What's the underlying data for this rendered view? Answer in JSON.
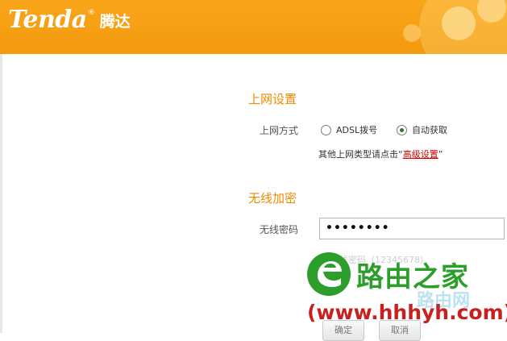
{
  "header": {
    "brand_en": "Tenda",
    "brand_reg": "®",
    "brand_cn": "腾达",
    "bg_color": "#f6a016"
  },
  "internet": {
    "section_title": "上网设置",
    "mode_label": "上网方式",
    "options": [
      {
        "label": "ADSL拨号",
        "selected": false
      },
      {
        "label": "自动获取",
        "selected": true
      }
    ],
    "hint_prefix": "其他上网类型请点击“",
    "hint_link": "高级设置",
    "hint_suffix": "”"
  },
  "wireless": {
    "section_title": "无线加密",
    "password_label": "无线密码",
    "password_value": "••••••••",
    "password_hint": "无线密码（12345678）"
  },
  "buttons": {
    "ok": "确定",
    "cancel": "取消"
  },
  "watermark": {
    "icon": "e-logo-icon",
    "name": "路由之家",
    "url": "(www.hhhyh.com)",
    "faint_text": "路由网"
  }
}
